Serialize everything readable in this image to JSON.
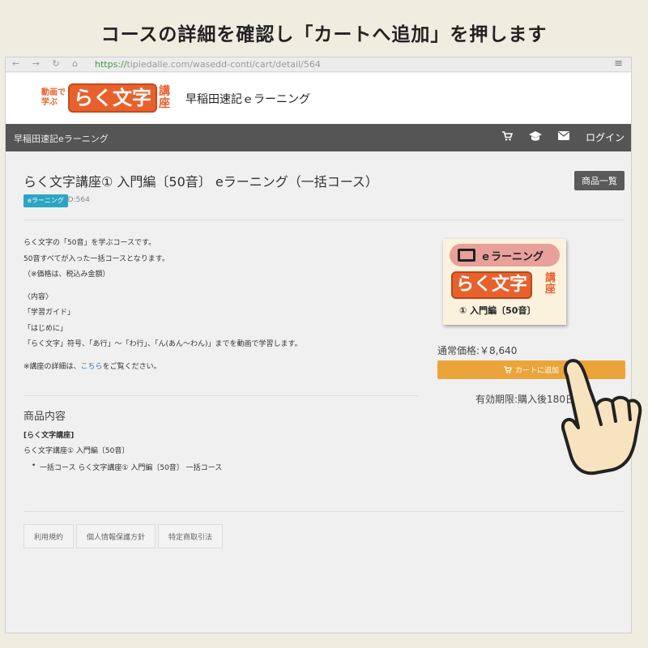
{
  "instruction": "コースの詳細を確認し「カートへ追加」を押します",
  "browser": {
    "url_proto": "https://",
    "url_rest": "tipiedalle.com/wasedd-conti/cart/detail/564",
    "nav_glyphs": "← → ↻ ⌂",
    "menu_glyph": "≡"
  },
  "header": {
    "logo_small_1": "動画で",
    "logo_small_2": "学ぶ",
    "logo_main": "らく文字",
    "logo_kouza_1": "講",
    "logo_kouza_2": "座",
    "site_name": "早稲田速記ｅラーニング"
  },
  "navbar": {
    "brand": "早稲田速記eラーニング",
    "cart_icon": "cart-icon",
    "graduation_icon": "graduation-cap-icon",
    "mail_icon": "mail-icon",
    "login": "ログイン"
  },
  "product": {
    "title": "らく文字講座① 入門編〔50音〕 eラーニング（一括コース）",
    "list_button": "商品一覧",
    "badge": "eラーニング",
    "id_text": "ID:564",
    "desc": [
      "らく文字の「50音」を学ぶコースです。",
      "50音すべてが入った一括コースとなります。",
      "（※価格は、税込み金額）",
      "〈内容〉",
      "「学習ガイド」",
      "「はじめに」",
      "「らく文字」符号、「あ行」～「わ行」、「ん(あん～わん)」までを動画で学習します。",
      "※講座の詳細は、",
      "こちら",
      "をご覧ください。"
    ],
    "image": {
      "top_label": "ｅラーニング",
      "main": "らく文字",
      "kouza_1": "講",
      "kouza_2": "座",
      "bottom": "① 入門編〔50音〕"
    },
    "price": "通常価格:￥8,640",
    "cart_button": "カートに追加",
    "expiry": "有効期限:購入後180日"
  },
  "contents": {
    "title": "商品内容",
    "bold": "[らく文字講座]",
    "line": "らく文字講座① 入門編〔50音〕",
    "item": "一括コース らく文字講座① 入門編〔50音〕 一括コース"
  },
  "footer": {
    "links": [
      "利用規約",
      "個人情報保護方針",
      "特定商取引法"
    ]
  },
  "colors": {
    "accent_orange": "#eba43a",
    "brand_orange": "#e8612c",
    "badge_teal": "#2aa6c4",
    "navbar": "#555555"
  }
}
